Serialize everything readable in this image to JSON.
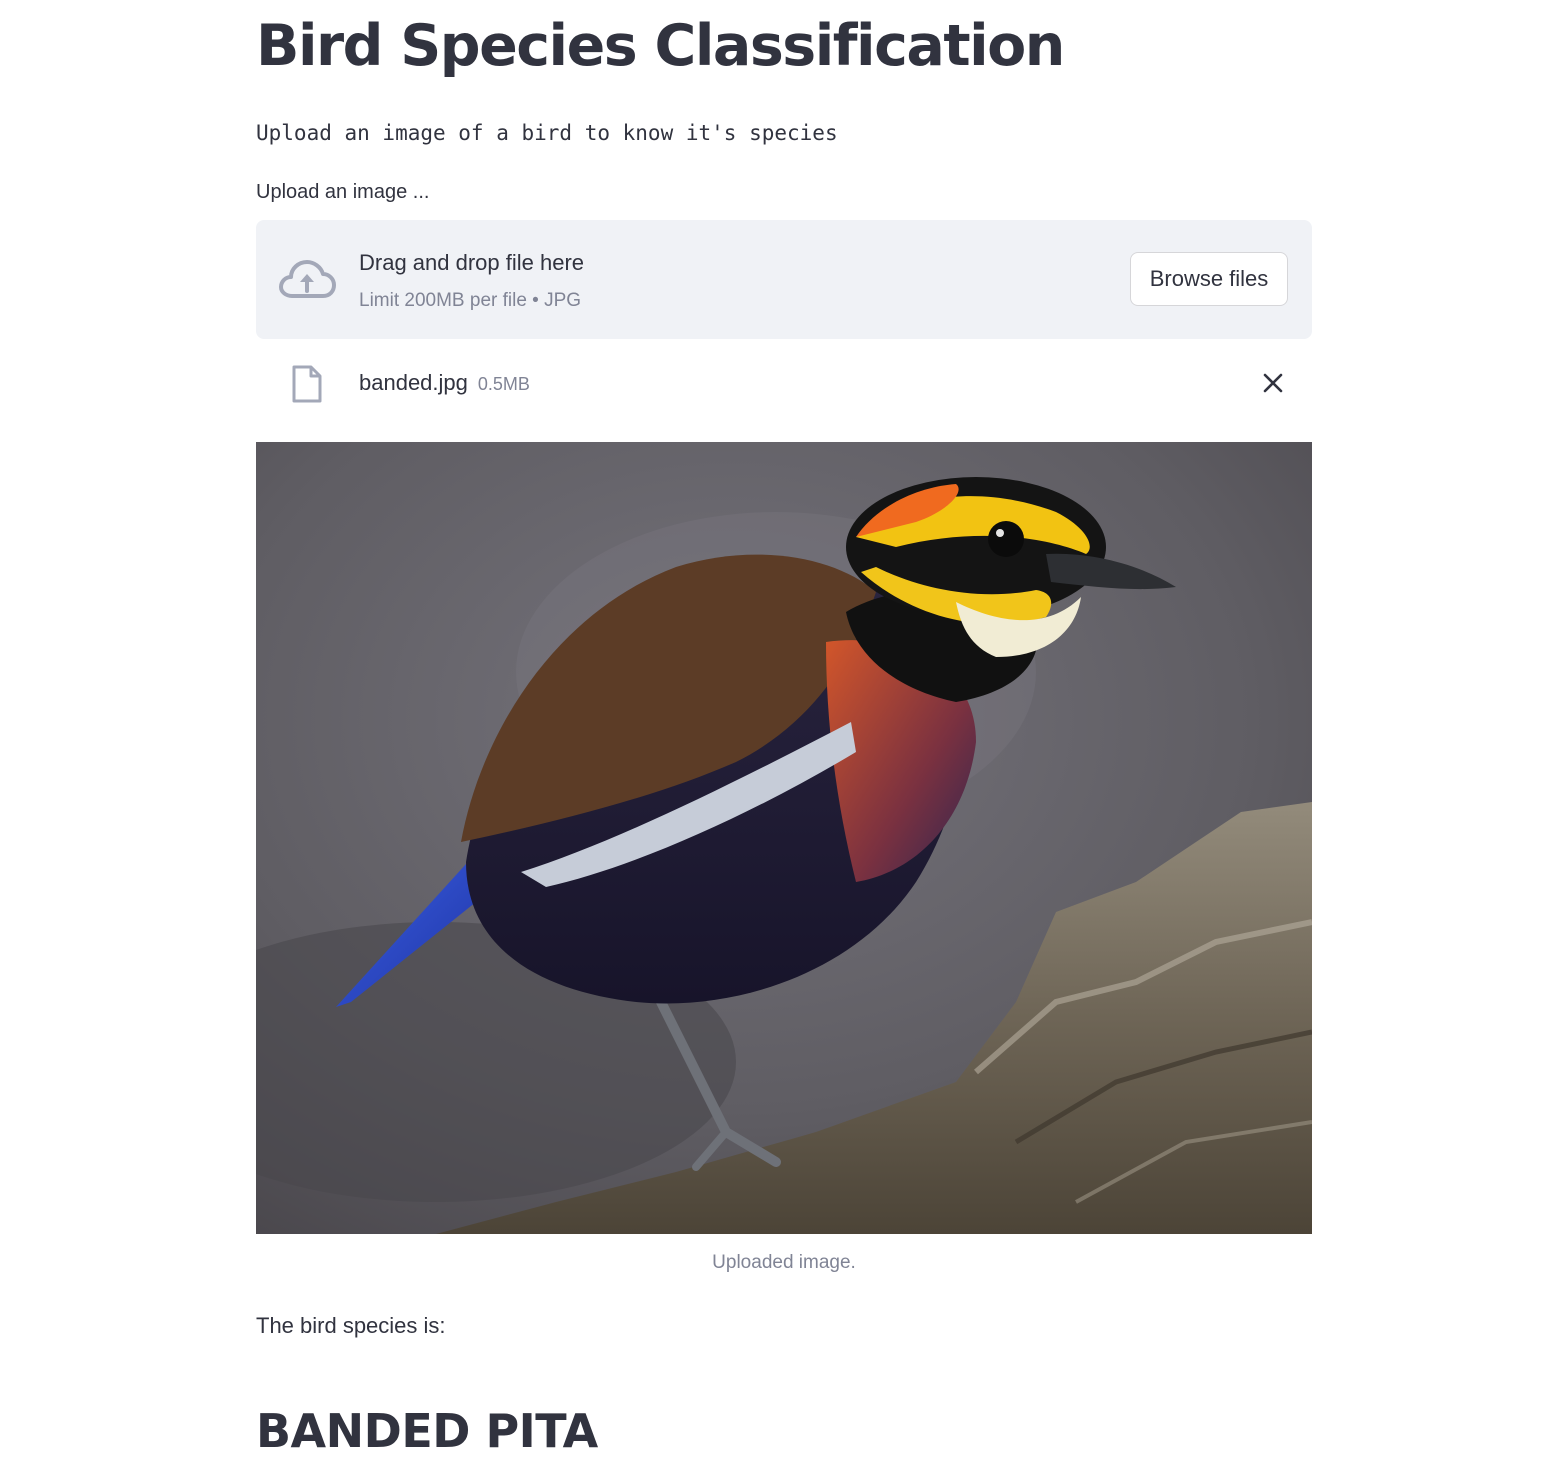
{
  "page": {
    "title": "Bird Species Classification",
    "subtitle": "Upload an image of a bird to know it's species"
  },
  "uploader": {
    "label": "Upload an image ...",
    "drop_text": "Drag and drop file here",
    "limit_text": "Limit 200MB per file • JPG",
    "browse_label": "Browse files",
    "icon": "cloud-upload-icon"
  },
  "uploaded_file": {
    "name": "banded.jpg",
    "size": "0.5MB",
    "icon": "file-icon",
    "remove_icon": "close-icon"
  },
  "image": {
    "caption": "Uploaded image."
  },
  "result": {
    "label": "The bird species is:",
    "species": "BANDED PITA"
  },
  "colors": {
    "text": "#31333f",
    "muted": "#808495",
    "dropzone_bg": "#f0f2f6",
    "icon": "#a3a8b8"
  }
}
